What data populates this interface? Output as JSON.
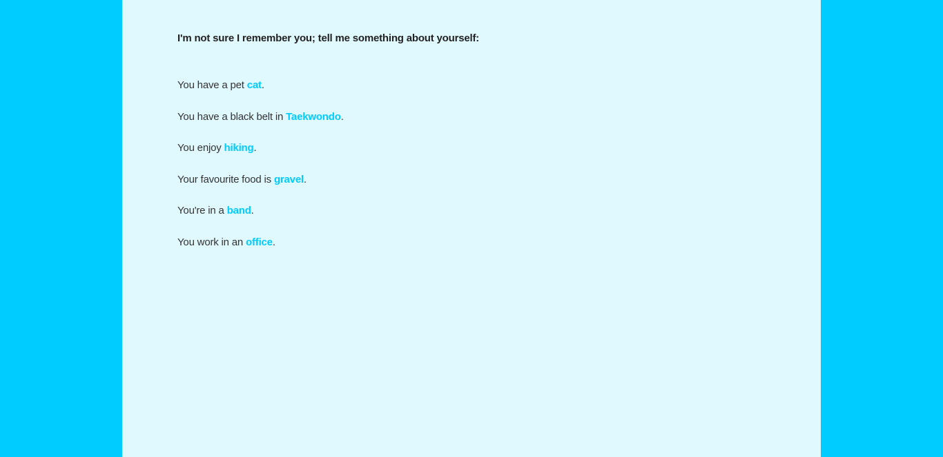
{
  "prompt": "I'm not sure I remember you; tell me something about yourself:",
  "choices": [
    {
      "before": "You have a pet ",
      "link": "cat",
      "after": "."
    },
    {
      "before": "You have a black belt in ",
      "link": "Taekwondo",
      "after": "."
    },
    {
      "before": "You enjoy ",
      "link": "hiking",
      "after": "."
    },
    {
      "before": "Your favourite food is ",
      "link": "gravel",
      "after": "."
    },
    {
      "before": "You're in a ",
      "link": "band",
      "after": "."
    },
    {
      "before": "You work in an ",
      "link": "office",
      "after": "."
    }
  ],
  "colors": {
    "background": "#00ccff",
    "page": "#e0f9ff",
    "link": "#00ccff",
    "text": "#333333"
  }
}
